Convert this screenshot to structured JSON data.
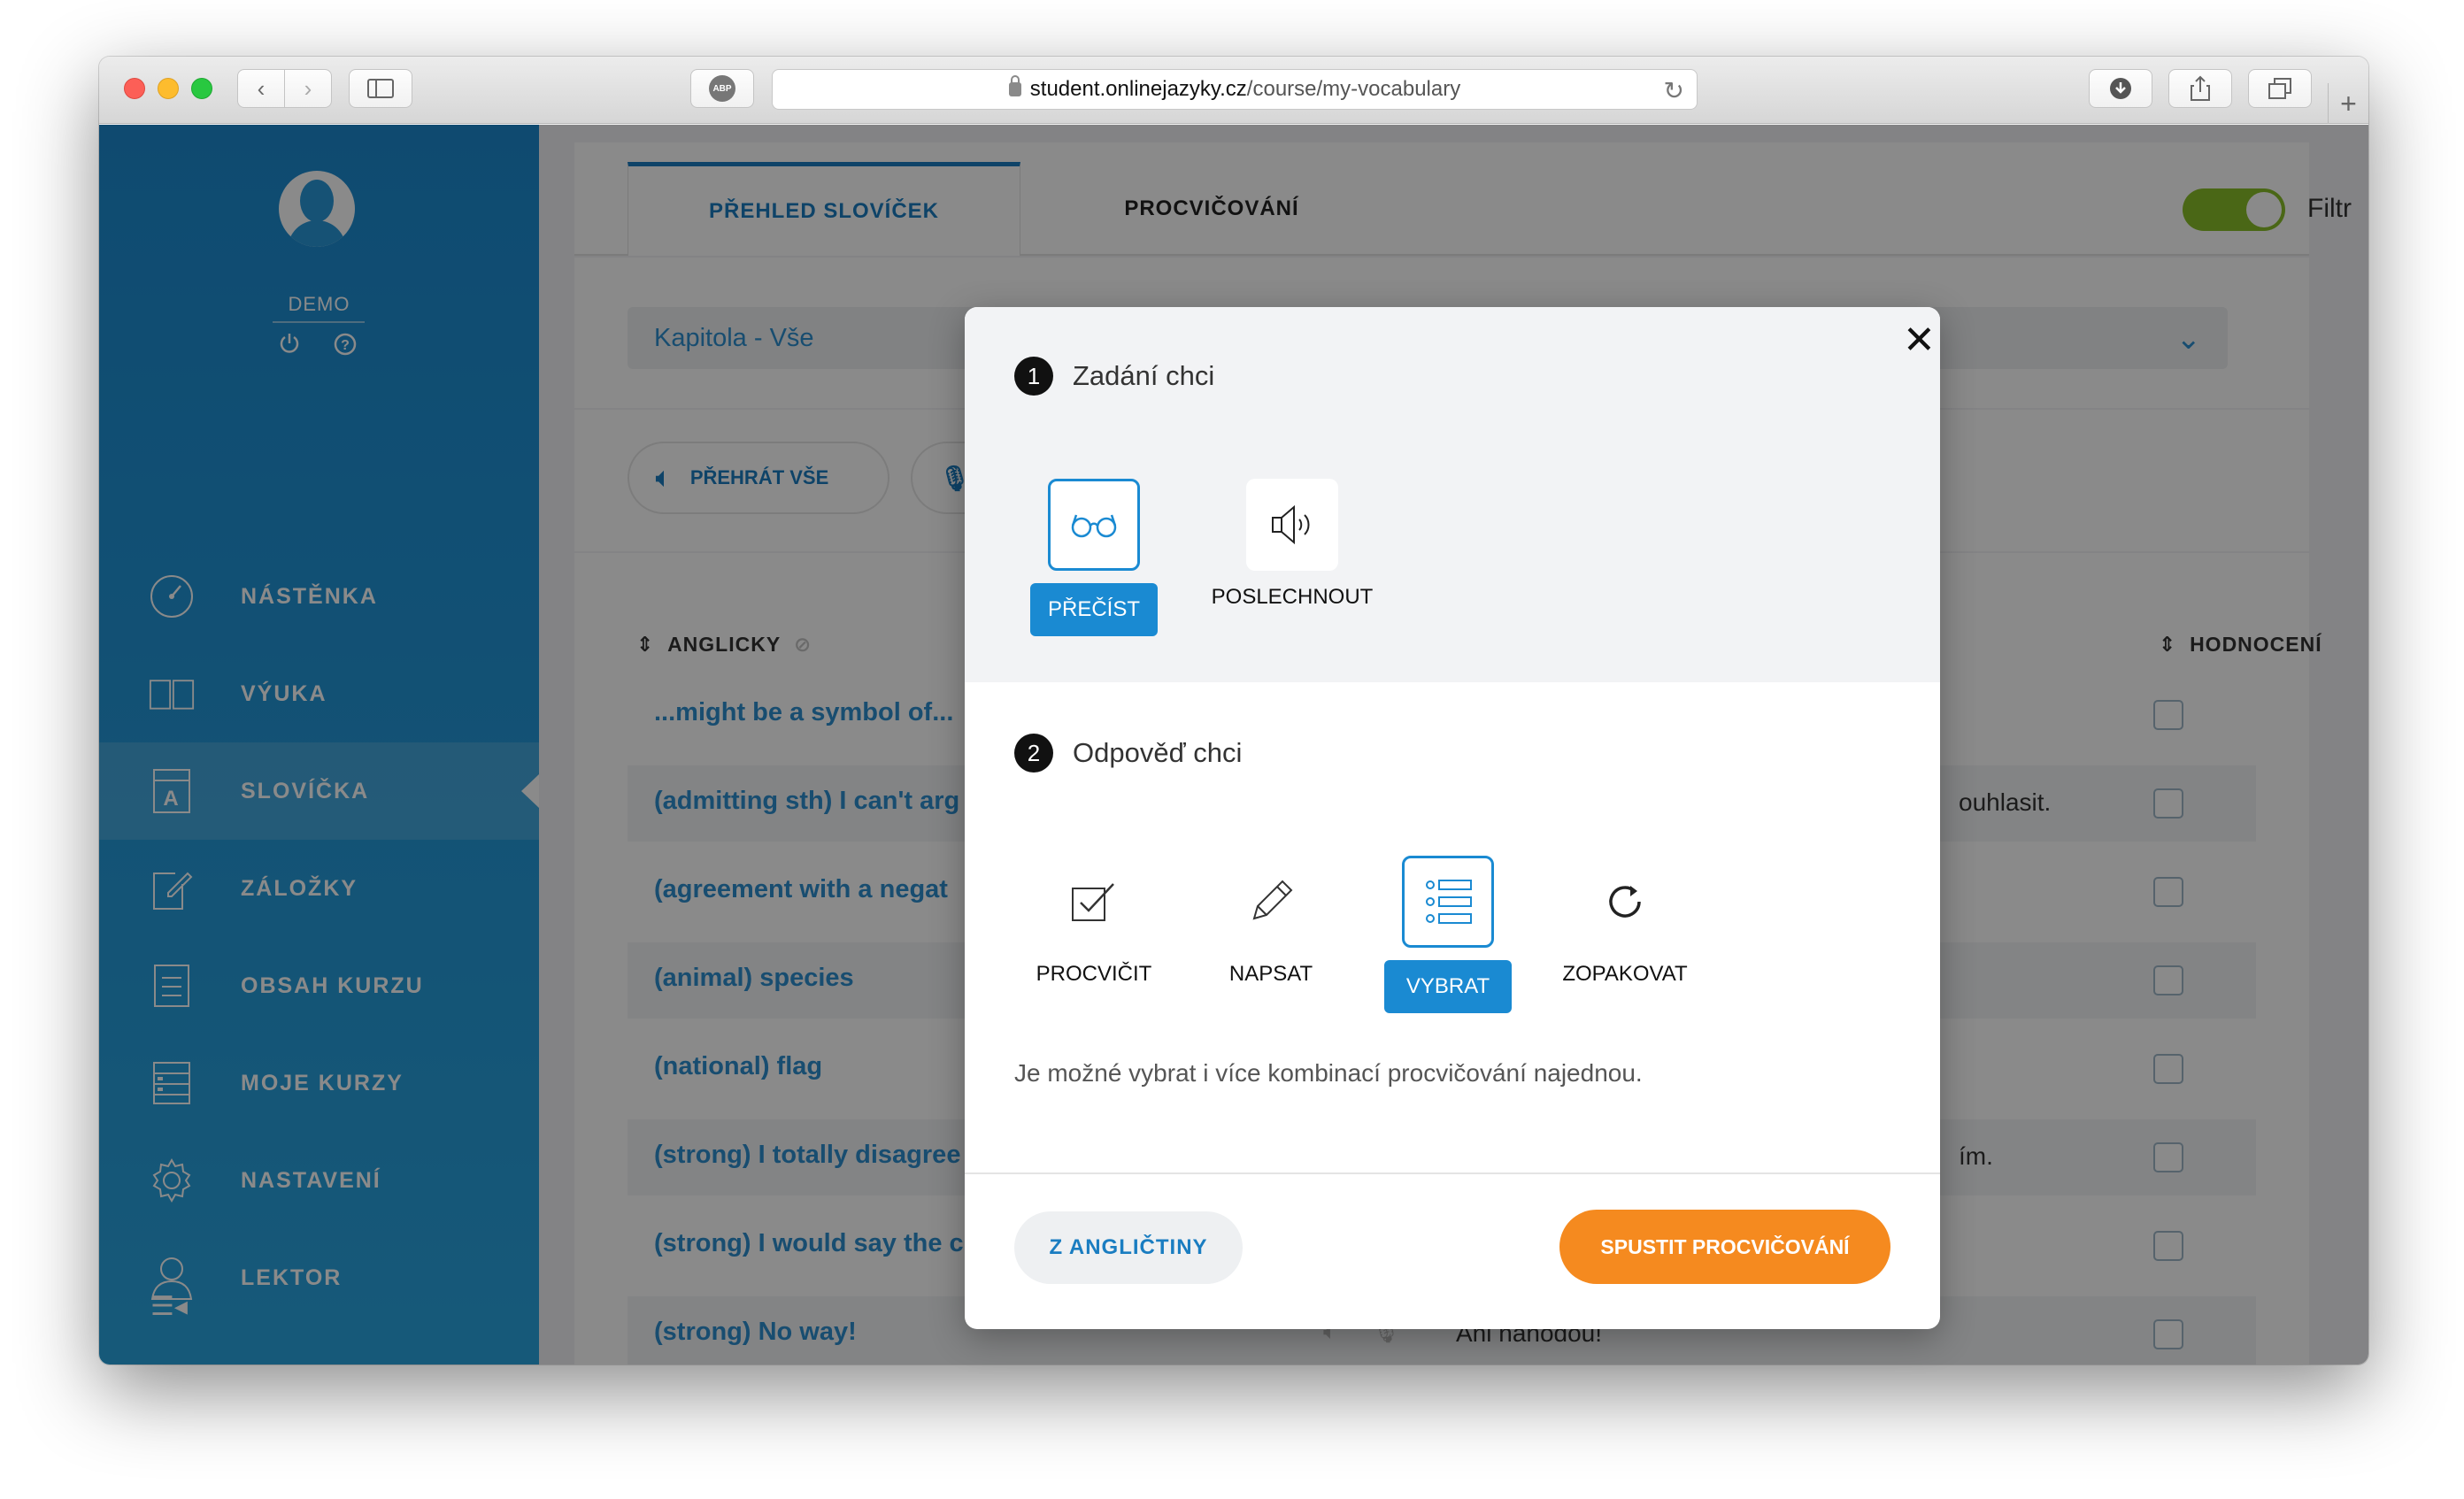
{
  "browser": {
    "url_domain": "student.onlinejazyky.cz",
    "url_path": "/course/my-vocabulary",
    "abp_label": "ABP",
    "new_tab": "+"
  },
  "sidebar": {
    "user": "DEMO",
    "items": [
      {
        "label": "NÁSTĚNKA",
        "icon": "dashboard-gauge-icon"
      },
      {
        "label": "VÝUKA",
        "icon": "book-icon"
      },
      {
        "label": "SLOVÍČKA",
        "icon": "vocabulary-card-icon",
        "active": true
      },
      {
        "label": "ZÁLOŽKY",
        "icon": "bookmark-edit-icon"
      },
      {
        "label": "OBSAH KURZU",
        "icon": "document-list-icon"
      },
      {
        "label": "MOJE KURZY",
        "icon": "courses-list-icon"
      },
      {
        "label": "NASTAVENÍ",
        "icon": "gear-icon"
      },
      {
        "label": "LEKTOR",
        "icon": "tutor-person-icon"
      }
    ],
    "active_letter": "A"
  },
  "tabs": {
    "overview": "PŘEHLED SLOVÍČEK",
    "practice": "PROCVIČOVÁNÍ",
    "filter_label": "Filtr",
    "filter_on": true
  },
  "chapter_select": {
    "value": "Kapitola - Vše"
  },
  "play_all": "PŘEHRÁT VŠE",
  "list": {
    "col_english": "ANGLICKY",
    "col_rating": "HODNOCENÍ",
    "rows": [
      {
        "en": "...might be a symbol of...",
        "cz": ""
      },
      {
        "en": "(admitting sth) I can't arg",
        "cz": "ouhlasit."
      },
      {
        "en": "(agreement with a negat",
        "cz": ""
      },
      {
        "en": "(animal) species",
        "cz": ""
      },
      {
        "en": "(national) flag",
        "cz": ""
      },
      {
        "en": "(strong) I totally disagree",
        "cz": "ím."
      },
      {
        "en": "(strong) I would say the c",
        "cz": ""
      },
      {
        "en": "(strong) No way!",
        "cz": "Ani náhodou!"
      }
    ]
  },
  "modal": {
    "step1_num": "1",
    "step1_title": "Zadání chci",
    "step1_options": [
      "PŘEČÍST",
      "POSLECHNOUT"
    ],
    "step2_num": "2",
    "step2_title": "Odpověď chci",
    "step2_options": [
      "PROCVIČIT",
      "NAPSAT",
      "VYBRAT",
      "ZOPAKOVAT"
    ],
    "hint": "Je možné vybrat i více kombinací procvičování najednou.",
    "direction_button": "Z ANGLIČTINY",
    "start_button": "SPUSTIT PROCVIČOVÁNÍ",
    "close": "✕",
    "accent_color": "#1a8ad2",
    "start_color": "#f58a1f"
  }
}
